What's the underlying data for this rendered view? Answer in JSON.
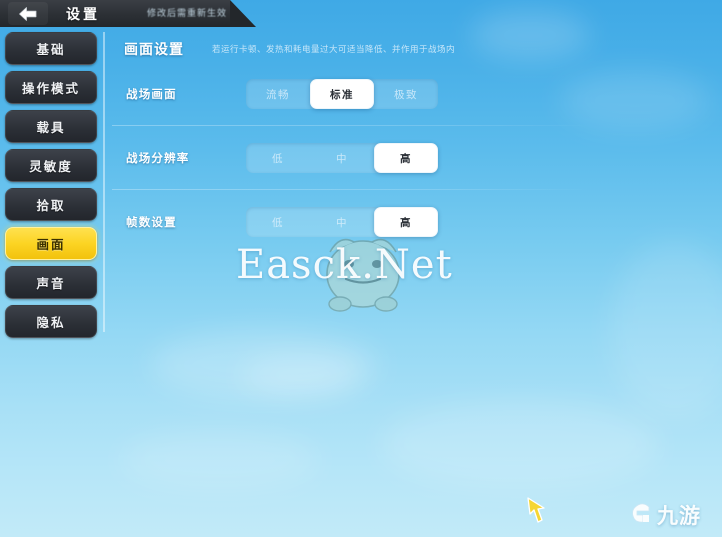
{
  "topbar": {
    "back_icon": "back-arrow-icon",
    "title": "设置",
    "subtitle": "修改后需重新生效"
  },
  "sidebar": {
    "items": [
      {
        "label": "基础",
        "active": false
      },
      {
        "label": "操作模式",
        "active": false
      },
      {
        "label": "载具",
        "active": false
      },
      {
        "label": "灵敏度",
        "active": false
      },
      {
        "label": "拾取",
        "active": false
      },
      {
        "label": "画面",
        "active": true
      },
      {
        "label": "声音",
        "active": false
      },
      {
        "label": "隐私",
        "active": false
      }
    ]
  },
  "panel": {
    "title": "画面设置",
    "description": "若运行卡顿、发热和耗电量过大可适当降低、并作用于战场内",
    "rows": [
      {
        "label": "战场画面",
        "options": [
          "流畅",
          "标准",
          "极致"
        ],
        "selected_index": 1
      },
      {
        "label": "战场分辨率",
        "options": [
          "低",
          "中",
          "高"
        ],
        "selected_index": 2
      },
      {
        "label": "帧数设置",
        "options": [
          "低",
          "中",
          "高"
        ],
        "selected_index": 2
      }
    ]
  },
  "watermark": {
    "text": "Easck.Net",
    "mascot_icon": "frog-mascot-icon"
  },
  "cursor": {
    "icon": "hand-cursor-icon"
  },
  "brand": {
    "logo_icon": "jiuyou-g-logo-icon",
    "text": "九游"
  },
  "colors": {
    "accent_yellow": "#fcd423",
    "panel_blue": "#3fa9e6",
    "sky_bottom": "#c2eaf8",
    "selected_white": "#ffffff",
    "sidebar_dark": "#2b2f36"
  }
}
